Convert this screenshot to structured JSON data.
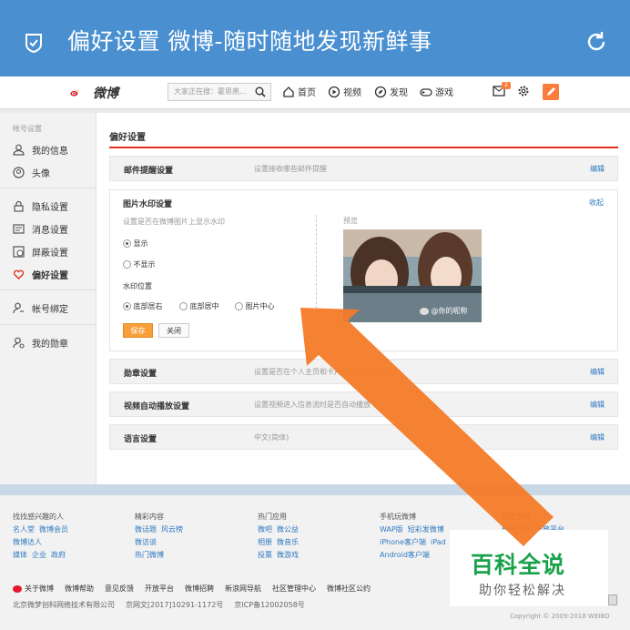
{
  "app_title": "偏好设置 微博-随时随地发现新鲜事",
  "nav": {
    "logo_text": "微博",
    "search_placeholder": "大家正在搜：霍思燕...",
    "items": [
      "首页",
      "视频",
      "发现",
      "游戏"
    ],
    "badge": "2"
  },
  "sidebar": {
    "header": "帐号设置",
    "items": [
      "我的信息",
      "头像",
      "隐私设置",
      "消息设置",
      "屏蔽设置",
      "偏好设置",
      "帐号绑定",
      "我的勋章"
    ]
  },
  "main": {
    "title": "偏好设置",
    "rows": [
      {
        "label": "邮件提醒设置",
        "desc": "设置接收哪些邮件提醒",
        "action": "编辑"
      },
      {
        "label": "勋章设置",
        "desc": "设置是否在个人主页和卡片中显示勋章图标",
        "action": "编辑"
      },
      {
        "label": "视频自动播放设置",
        "desc": "设置视频进入信息流时是否自动播放",
        "action": "编辑"
      },
      {
        "label": "语言设置",
        "desc": "中文(简体)",
        "action": "编辑"
      }
    ],
    "watermark": {
      "title": "图片水印设置",
      "collapse": "收起",
      "subtitle": "设置是否在微博图片上显示水印",
      "show": "显示",
      "hide": "不显示",
      "position_label": "水印位置",
      "positions": [
        "底部居右",
        "底部居中",
        "图片中心"
      ],
      "preview_label": "预览",
      "preview_tag": "@你的昵称",
      "save": "保存",
      "close": "关闭"
    }
  },
  "footer": {
    "cols": [
      {
        "h": "找找感兴趣的人",
        "links": [
          [
            "名人堂",
            "微博会员"
          ],
          [
            "微博达人"
          ],
          [
            "媒体",
            "企业",
            "政府"
          ]
        ]
      },
      {
        "h": "精彩内容",
        "links": [
          [
            "微话题",
            "风云榜"
          ],
          [
            "微访谈"
          ],
          [
            "热门微博"
          ]
        ]
      },
      {
        "h": "热门应用",
        "links": [
          [
            "微吧",
            "微公益"
          ],
          [
            "相册",
            "微音乐"
          ],
          [
            "投票",
            "微游戏"
          ]
        ]
      },
      {
        "h": "手机玩微博",
        "links": [
          [
            "WAP版",
            "短彩发微博"
          ],
          [
            "iPhone客户端",
            "iPad"
          ],
          [
            "Android客户端"
          ]
        ]
      },
      {
        "h": "认证合作",
        "links": [
          [
            "申请认证",
            "开放平台"
          ]
        ]
      }
    ],
    "links": [
      "关于微博",
      "微博帮助",
      "意见反馈",
      "开放平台",
      "微博招聘",
      "新浪网导航",
      "社区管理中心",
      "微博社区公约"
    ],
    "company": [
      "北京微梦创科网络技术有限公司",
      "京网文[2017]10291-1172号",
      "京ICP备12002058号"
    ],
    "copyright": "Copyright © 2009-2018 WEIBO"
  },
  "overlay": {
    "line1": "百科全说",
    "line2": "助你轻松解决"
  },
  "colors": {
    "topbar": "#4a90d1",
    "accent": "#fa7d3c",
    "arrow": "#f47a28",
    "red": "#e0301e"
  }
}
